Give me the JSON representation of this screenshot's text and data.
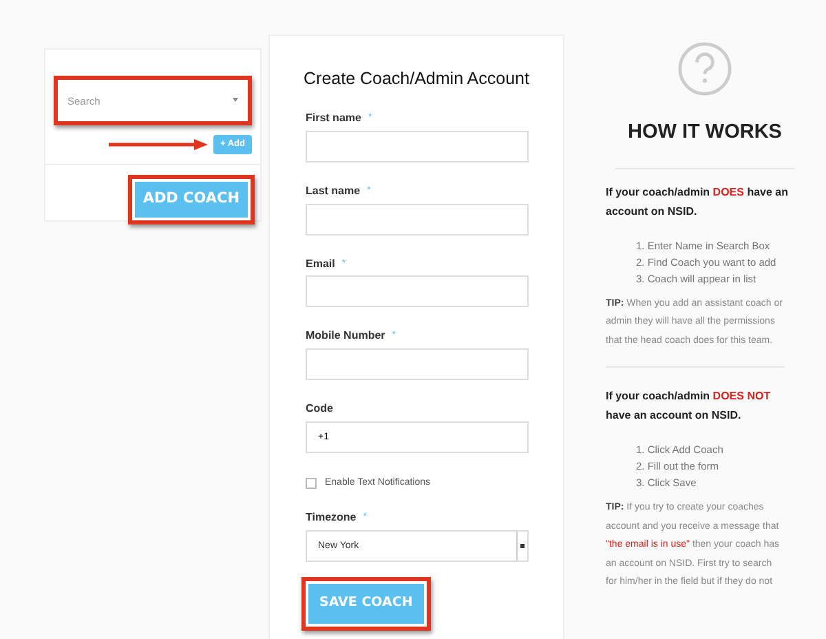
{
  "search_panel": {
    "search": {
      "placeholder": "Search"
    },
    "add_button": "+ Add",
    "add_coach_button": "ADD COACH"
  },
  "form": {
    "title": "Create Coach/Admin Account",
    "fields": [
      {
        "kind": "text",
        "label": "First name",
        "required_mark": "*"
      },
      {
        "kind": "text",
        "label": "Last name",
        "required_mark": "*"
      },
      {
        "kind": "text",
        "label": "Email",
        "required_mark": "*"
      },
      {
        "kind": "text",
        "label": "Mobile Number",
        "required_mark": "*"
      },
      {
        "kind": "text",
        "label": "Code",
        "value": "+1"
      },
      {
        "kind": "checkbox",
        "label": "Enable Text Notifications",
        "checked": false
      },
      {
        "kind": "select",
        "label": "Timezone",
        "required_mark": "*",
        "value": "New York"
      }
    ],
    "save_button": "SAVE COACH"
  },
  "help": {
    "title": "HOW IT WORKS",
    "sections": [
      {
        "heading": [
          [
            {
              "text": "If your coach/admin "
            },
            {
              "text": "DOES",
              "red": true
            },
            {
              "text": " have an"
            }
          ],
          [
            {
              "text": "account on NSID."
            }
          ]
        ],
        "steps": [
          "1. Enter Name in Search Box",
          "2. Find Coach you want to add",
          "3. Coach will appear in list"
        ],
        "tip": [
          [
            {
              "text": "**TIP:** When you add an assistant coach or"
            }
          ],
          [
            {
              "text": "admin they will have all the permissions"
            }
          ],
          [
            {
              "text": "that the head coach does for this team."
            }
          ]
        ]
      },
      {
        "heading": [
          [
            {
              "text": "If your coach/admin "
            },
            {
              "text": "DOES NOT",
              "red": true
            }
          ],
          [
            {
              "text": "have an account on NSID."
            }
          ]
        ],
        "steps": [
          "1. Click Add Coach",
          "2. Fill out the form",
          "3. Click Save"
        ],
        "tip": [
          [
            {
              "text": "**TIP:** If you try to create your coaches"
            }
          ],
          [
            {
              "text": "account and you receive a message that"
            }
          ],
          [
            {
              "text": "\"the email is in use\"",
              "red": true
            },
            {
              "text": " then your coach has"
            }
          ],
          [
            {
              "text": "an account on NSID. First try to search"
            }
          ],
          [
            {
              "text": "for him/her in the field but if they do not"
            }
          ]
        ]
      }
    ]
  }
}
